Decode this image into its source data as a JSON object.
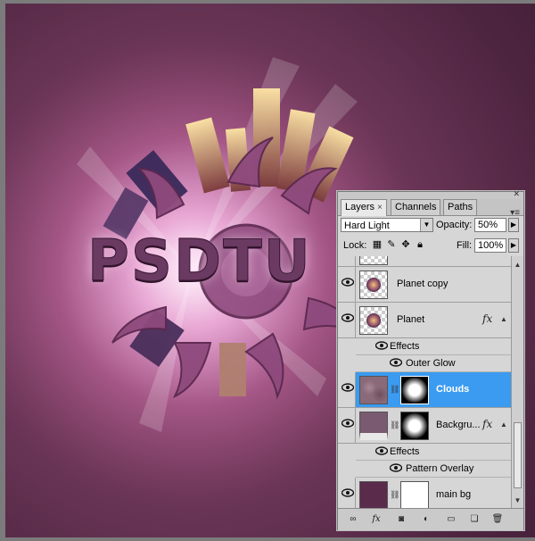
{
  "layers_panel": {
    "tabs": [
      {
        "label": "Layers",
        "close": "×"
      },
      {
        "label": "Channels"
      },
      {
        "label": "Paths"
      }
    ],
    "blend_mode": "Hard Light",
    "opacity_label": "Opacity:",
    "opacity_value": "50%",
    "lock_label": "Lock:",
    "fill_label": "Fill:",
    "fill_value": "100%",
    "layers": [
      {
        "name": "Planet copy"
      },
      {
        "name": "Planet",
        "fx": "fx"
      },
      {
        "name": "Effects"
      },
      {
        "name": "Outer Glow"
      },
      {
        "name": "Clouds",
        "selected": true
      },
      {
        "name": "Backgru...",
        "fx": "fx"
      },
      {
        "name": "Effects"
      },
      {
        "name": "Pattern Overlay"
      },
      {
        "name": "main bg"
      }
    ],
    "bottom_icons": [
      "link-layers-icon",
      "fx-icon",
      "mask-icon",
      "adjustment-icon",
      "group-icon",
      "new-layer-icon",
      "trash-icon"
    ]
  },
  "artwork": {
    "title_text": "PSDTU"
  },
  "colors": {
    "selection": "#3b9bf0",
    "panel_bg": "#d6d6d6",
    "canvas_bg": "#5a2b4a"
  }
}
